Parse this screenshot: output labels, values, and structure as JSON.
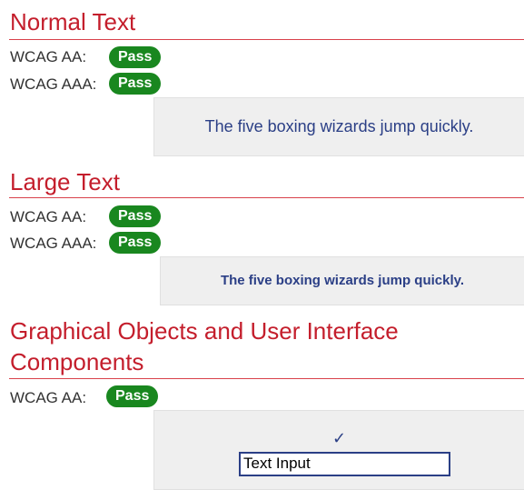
{
  "sections": {
    "normal": {
      "title": "Normal Text",
      "aa_label": "WCAG AA:",
      "aa_result": "Pass",
      "aaa_label": "WCAG AAA:",
      "aaa_result": "Pass",
      "sample": "The five boxing wizards jump quickly."
    },
    "large": {
      "title": "Large Text",
      "aa_label": "WCAG AA:",
      "aa_result": "Pass",
      "aaa_label": "WCAG AAA:",
      "aaa_result": "Pass",
      "sample": "The five boxing wizards jump quickly."
    },
    "graphical": {
      "title_line1": "Graphical Objects and User Interface",
      "title_line2": "Components",
      "aa_label": "WCAG AA:",
      "aa_result": "Pass",
      "checkmark": "✓",
      "input_value": "Text Input"
    }
  },
  "colors": {
    "heading": "#c41e2c",
    "pass_badge": "#19871f",
    "foreground": "#2b3f86",
    "panel_background": "#efefef"
  }
}
